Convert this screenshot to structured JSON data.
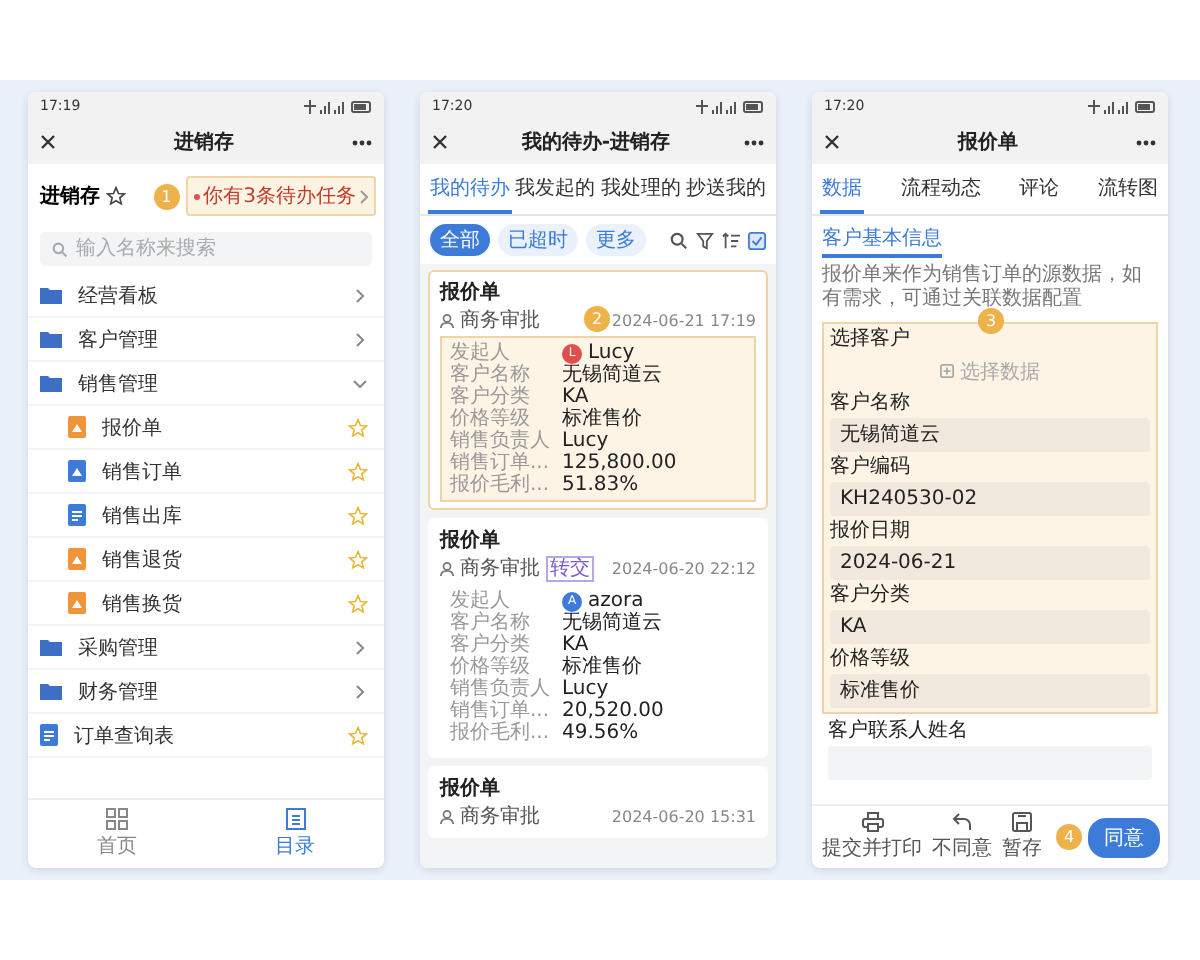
{
  "phones": [
    {
      "kind": "catalog",
      "time": "17:19",
      "title": "进销存",
      "header": {
        "app_name": "进销存",
        "badge": "1",
        "notice": "你有3条待办任务"
      },
      "search": {
        "placeholder": "输入名称来搜索"
      },
      "tree": [
        {
          "label": "经营看板",
          "kind": "folder",
          "expanded": false
        },
        {
          "label": "客户管理",
          "kind": "folder",
          "expanded": false
        },
        {
          "label": "销售管理",
          "kind": "folder",
          "expanded": true,
          "children": [
            {
              "label": "报价单",
              "kind": "form",
              "color": "#f0943a"
            },
            {
              "label": "销售订单",
              "kind": "form",
              "color": "#3d7bd9"
            },
            {
              "label": "销售出库",
              "kind": "doc",
              "color": "#3d7bd9"
            },
            {
              "label": "销售退货",
              "kind": "form",
              "color": "#f0943a"
            },
            {
              "label": "销售换货",
              "kind": "form",
              "color": "#f0943a"
            }
          ]
        },
        {
          "label": "采购管理",
          "kind": "folder",
          "expanded": false
        },
        {
          "label": "财务管理",
          "kind": "folder",
          "expanded": false
        },
        {
          "label": "订单查询表",
          "kind": "doc",
          "color": "#3d7bd9"
        }
      ],
      "nav": [
        {
          "label": "首页",
          "selected": false
        },
        {
          "label": "目录",
          "selected": true
        }
      ]
    },
    {
      "kind": "todo",
      "time": "17:20",
      "title": "我的待办-进销存",
      "tabs": [
        {
          "label": "我的待办",
          "selected": true
        },
        {
          "label": "我发起的",
          "selected": false
        },
        {
          "label": "我处理的",
          "selected": false
        },
        {
          "label": "抄送我的",
          "selected": false
        }
      ],
      "chips": [
        {
          "label": "全部",
          "selected": true
        },
        {
          "label": "已超时",
          "selected": false
        },
        {
          "label": "更多",
          "selected": false
        }
      ],
      "cards": [
        {
          "title": "报价单",
          "step": "商务审批",
          "time": "2024-06-21 17:19",
          "highlighted": true,
          "badge": "2",
          "fields": [
            {
              "label": "发起人",
              "value": "Lucy",
              "avatar": "L",
              "color": "#e0504a"
            },
            {
              "label": "客户名称",
              "value": "无锡简道云"
            },
            {
              "label": "客户分类",
              "value": "KA"
            },
            {
              "label": "价格等级",
              "value": "标准售价"
            },
            {
              "label": "销售负责人",
              "value": "Lucy"
            },
            {
              "label": "销售订单...",
              "value": "125,800.00"
            },
            {
              "label": "报价毛利...",
              "value": "51.83%"
            }
          ]
        },
        {
          "title": "报价单",
          "step": "商务审批",
          "tag": "转交",
          "time": "2024-06-20 22:12",
          "highlighted": false,
          "fields": [
            {
              "label": "发起人",
              "value": "azora",
              "avatar": "A",
              "color": "#3d7bd9"
            },
            {
              "label": "客户名称",
              "value": "无锡简道云"
            },
            {
              "label": "客户分类",
              "value": "KA"
            },
            {
              "label": "价格等级",
              "value": "标准售价"
            },
            {
              "label": "销售负责人",
              "value": "Lucy"
            },
            {
              "label": "销售订单...",
              "value": "20,520.00"
            },
            {
              "label": "报价毛利...",
              "value": "49.56%"
            }
          ]
        },
        {
          "title": "报价单",
          "step": "商务审批",
          "time": "2024-06-20 15:31",
          "highlighted": false
        }
      ]
    },
    {
      "kind": "form",
      "time": "17:20",
      "title": "报价单",
      "tabs": [
        {
          "label": "数据",
          "selected": true
        },
        {
          "label": "流程动态",
          "selected": false
        },
        {
          "label": "评论",
          "selected": false
        },
        {
          "label": "流转图",
          "selected": false
        }
      ],
      "section": "客户基本信息",
      "description": "报价单来作为销售订单的源数据，如有需求，可通过关联数据配置",
      "badge": "3",
      "highlighted_fields": [
        {
          "label": "选择客户",
          "kind": "picker",
          "button": "选择数据"
        },
        {
          "label": "客户名称",
          "kind": "input",
          "value": "无锡简道云"
        },
        {
          "label": "客户编码",
          "kind": "input",
          "value": "KH240530-02"
        },
        {
          "label": "报价日期",
          "kind": "input",
          "value": "2024-06-21"
        },
        {
          "label": "客户分类",
          "kind": "input",
          "value": "KA"
        },
        {
          "label": "价格等级",
          "kind": "input",
          "value": "标准售价"
        }
      ],
      "fields": [
        {
          "label": "客户联系人姓名",
          "kind": "input"
        }
      ],
      "actions": [
        {
          "label": "提交并打印",
          "kind": "print"
        },
        {
          "label": "不同意",
          "kind": "back"
        },
        {
          "label": "暂存",
          "kind": "save"
        }
      ],
      "primary": {
        "label": "同意",
        "badge": "4"
      }
    }
  ]
}
